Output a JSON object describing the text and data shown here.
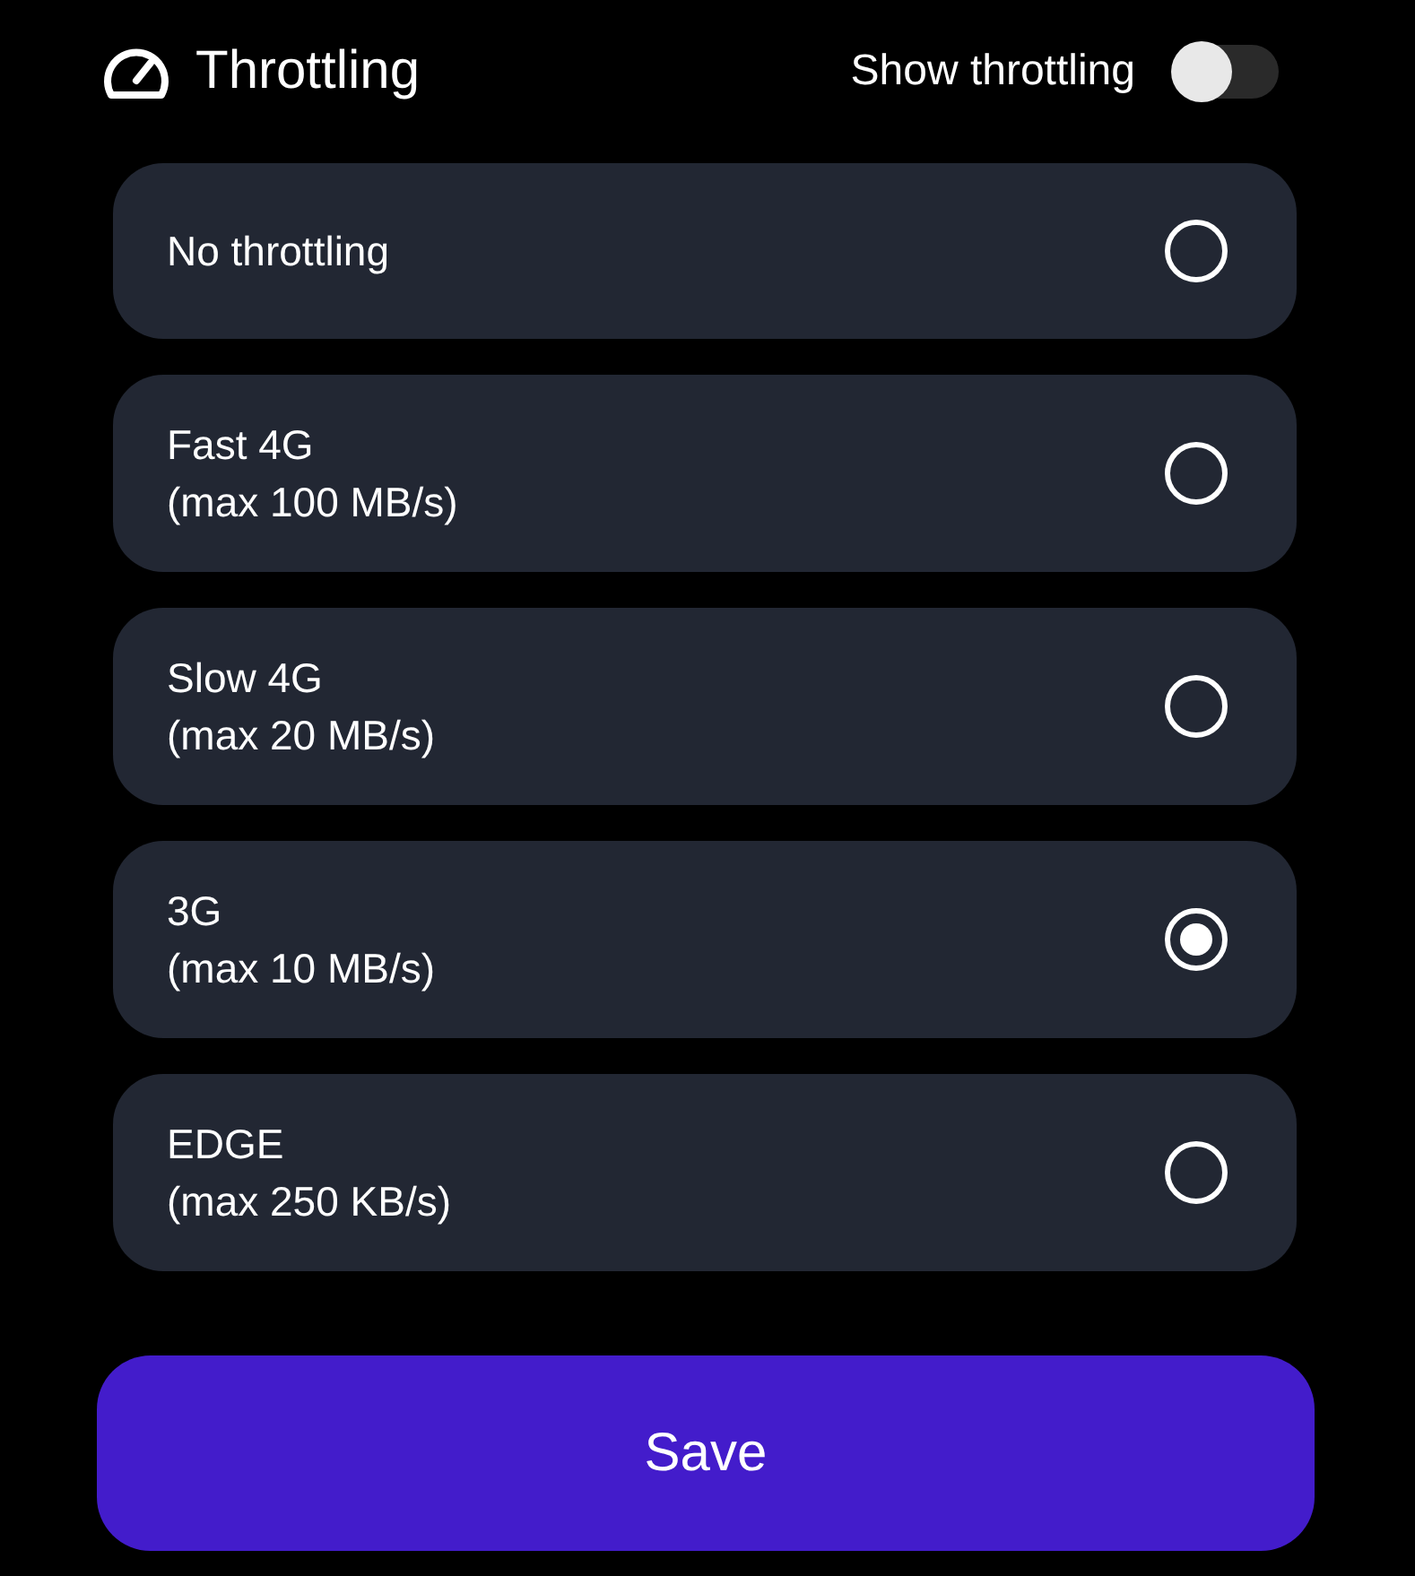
{
  "header": {
    "title": "Throttling",
    "toggle": {
      "label": "Show throttling",
      "on": false
    }
  },
  "options": [
    {
      "label": "No throttling",
      "selected": false
    },
    {
      "label": "Fast 4G",
      "detail": "(max 100 MB/s)",
      "selected": false
    },
    {
      "label": "Slow 4G",
      "detail": "(max 20 MB/s)",
      "selected": false
    },
    {
      "label": "3G",
      "detail": "(max 10 MB/s)",
      "selected": true
    },
    {
      "label": "EDGE",
      "detail": "(max 250 KB/s)",
      "selected": false
    }
  ],
  "save_button": {
    "label": "Save"
  }
}
